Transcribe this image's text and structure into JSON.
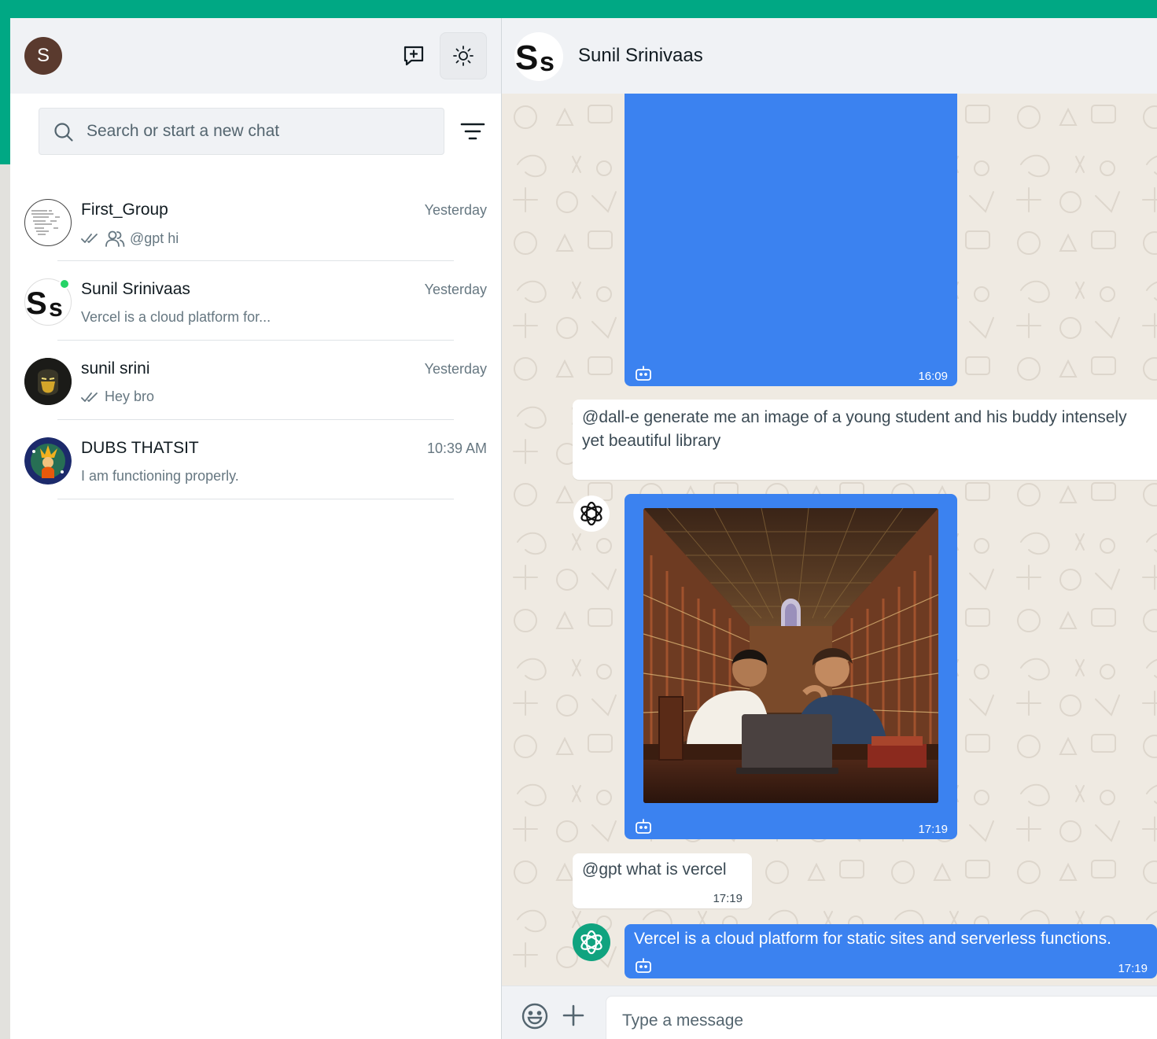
{
  "user": {
    "initial": "S"
  },
  "header_icons": {
    "new_chat": "new-chat-icon",
    "theme": "sun-icon"
  },
  "search": {
    "placeholder": "Search or start a new chat",
    "icon": "search-icon",
    "filter_icon": "filter-icon"
  },
  "chats": [
    {
      "name": "First_Group",
      "time": "Yesterday",
      "preview": "@gpt hi",
      "read_ticks": true,
      "group_icon": true
    },
    {
      "name": "Sunil Srinivaas",
      "time": "Yesterday",
      "preview": "Vercel is a cloud platform for...",
      "online": true
    },
    {
      "name": "sunil srini",
      "time": "Yesterday",
      "preview": "Hey bro",
      "read_ticks": true
    },
    {
      "name": "DUBS THATSIT",
      "time": "10:39 AM",
      "preview": "I am functioning properly."
    }
  ],
  "conversation": {
    "title": "Sunil Srinivaas",
    "avatar_text": "Ss",
    "messages": [
      {
        "type": "bot-image",
        "time": "16:09"
      },
      {
        "type": "user",
        "text_line1": "@dall-e generate me an image of a young student and his buddy intensely",
        "text_line2": "yet beautiful library"
      },
      {
        "type": "bot-image",
        "time": "17:19"
      },
      {
        "type": "user",
        "text": "@gpt what is vercel",
        "time": "17:19"
      },
      {
        "type": "bot-text",
        "text": "Vercel is a cloud platform for static sites and serverless functions.",
        "time": "17:19"
      }
    ]
  },
  "composer": {
    "placeholder": "Type a message",
    "emoji_icon": "emoji-icon",
    "attach_icon": "plus-icon"
  },
  "colors": {
    "accent": "#00a884",
    "bot_bubble": "#3b82f0",
    "online": "#25d366",
    "openai_green": "#10a37f"
  }
}
